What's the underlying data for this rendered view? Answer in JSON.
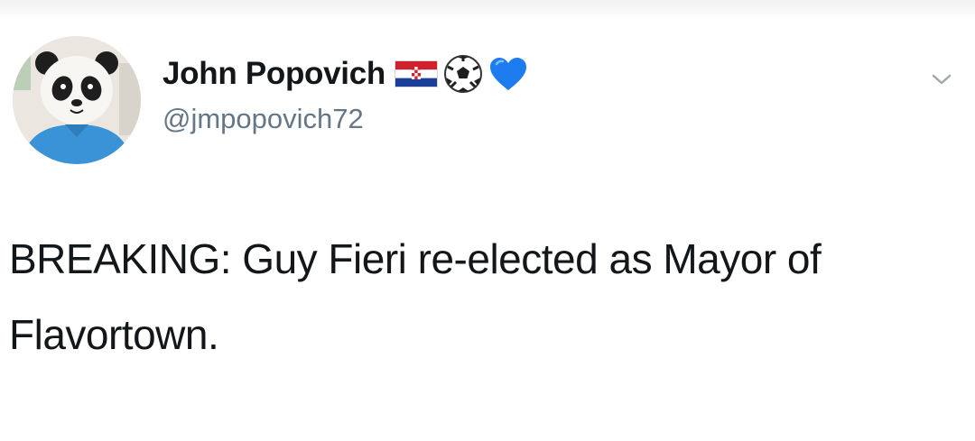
{
  "tweet": {
    "author": {
      "display_name": "John Popovich",
      "handle": "@jmpopovich72",
      "name_emojis": [
        "croatia-flag-icon",
        "soccer-ball-icon",
        "blue-heart-icon"
      ]
    },
    "text": "BREAKING: Guy Fieri re-elected as Mayor of Flavortown."
  },
  "colors": {
    "text_primary": "#14171a",
    "text_secondary": "#657786",
    "heart_blue": "#1d7df0",
    "avatar_shirt": "#3a93d6"
  },
  "icons": {
    "menu": "chevron-down-icon",
    "avatar": "panda-head-avatar"
  }
}
